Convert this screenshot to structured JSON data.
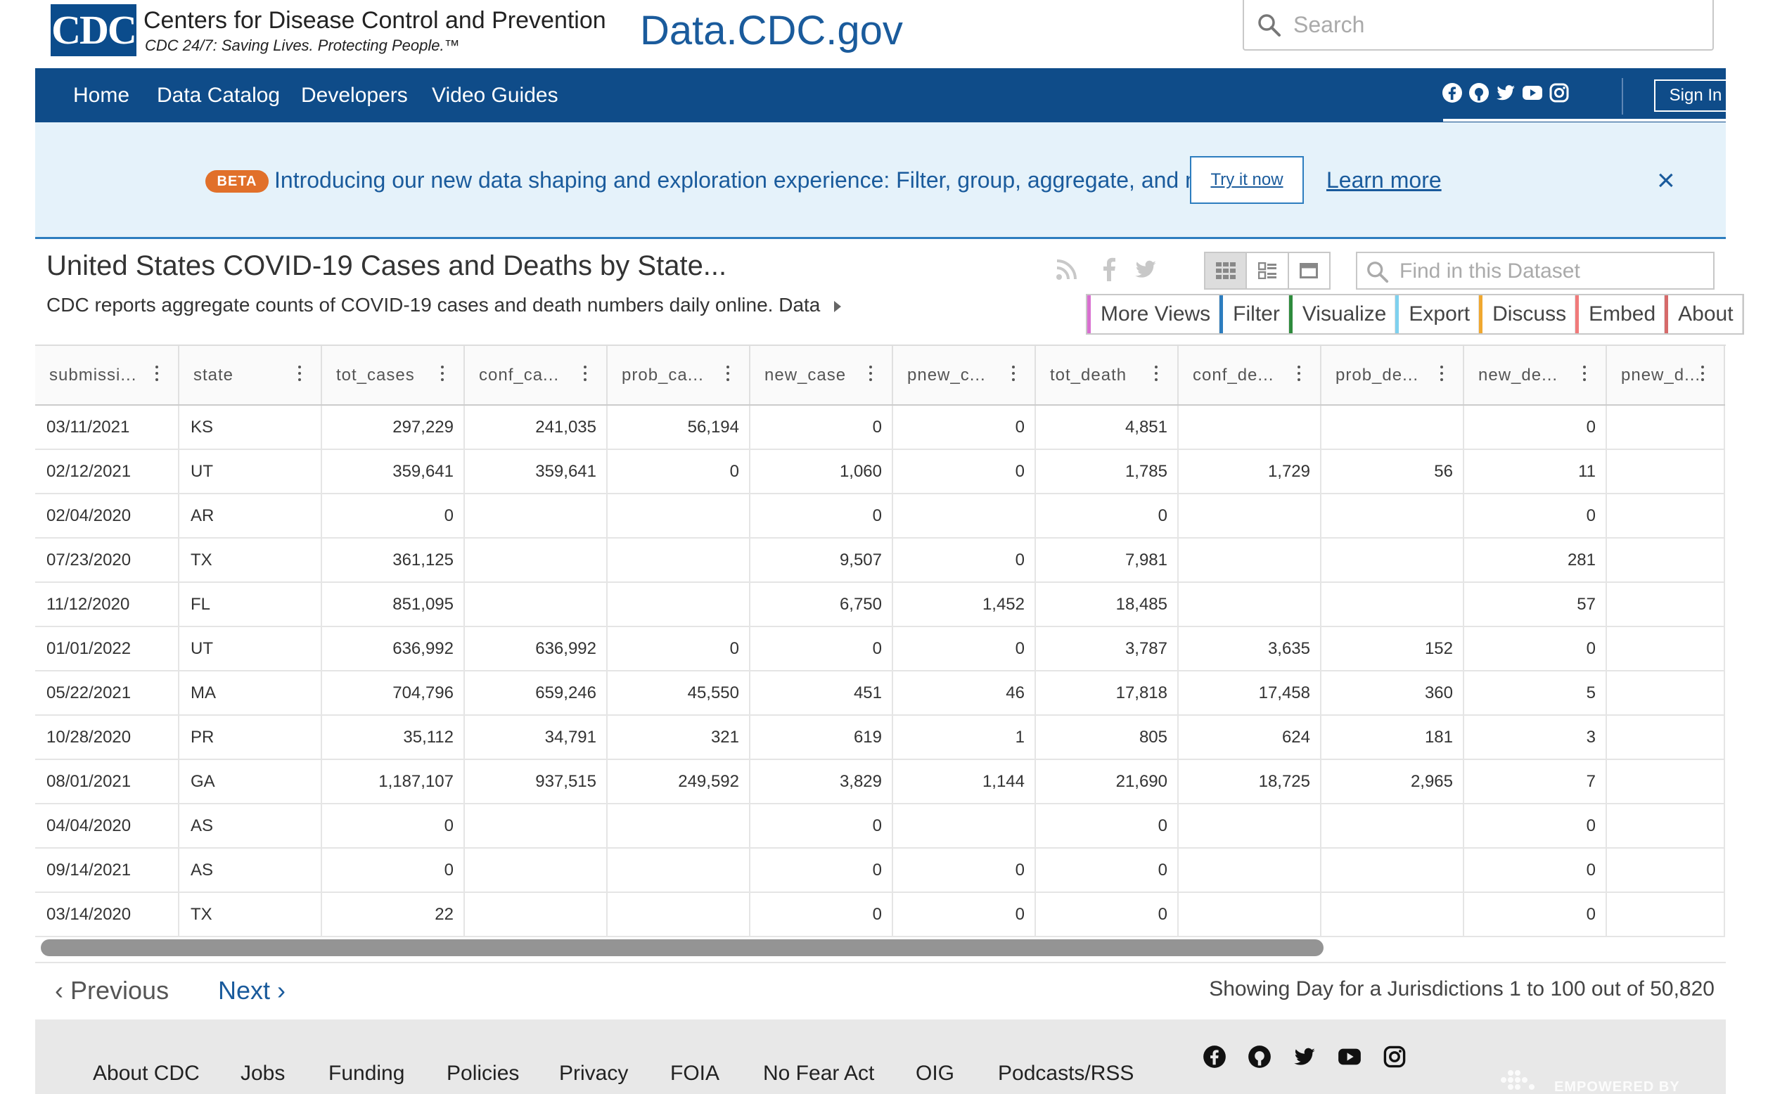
{
  "header": {
    "logo_text": "CDC",
    "org_name": "Centers for Disease Control and Prevention",
    "tagline": "CDC 24/7: Saving Lives. Protecting People.™",
    "portal_title": "Data.CDC.gov",
    "search_placeholder": "Search"
  },
  "nav": {
    "items": [
      "Home",
      "Data Catalog",
      "Developers",
      "Video Guides"
    ],
    "sign_in": "Sign In",
    "social_icons": [
      "facebook-icon",
      "github-icon",
      "twitter-icon",
      "youtube-icon",
      "instagram-icon"
    ]
  },
  "banner": {
    "badge": "BETA",
    "message": "Introducing our new data shaping and exploration experience: Filter, group, aggregate, and more!",
    "try_label": "Try it now",
    "learn_label": "Learn more",
    "close": "×"
  },
  "dataset": {
    "title": "United States COVID-19 Cases and Deaths by State...",
    "description": "CDC reports aggregate counts of COVID-19 cases and death numbers daily online. Data",
    "find_placeholder": "Find in this Dataset",
    "tabs": [
      {
        "label": "More Views",
        "color": "#d86fd0"
      },
      {
        "label": "Filter",
        "color": "#2d7dbf"
      },
      {
        "label": "Visualize",
        "color": "#2e8b3c"
      },
      {
        "label": "Export",
        "color": "#7fd1ee"
      },
      {
        "label": "Discuss",
        "color": "#f0a830"
      },
      {
        "label": "Embed",
        "color": "#f07a7a"
      },
      {
        "label": "About",
        "color": "#d66a6a"
      }
    ]
  },
  "table": {
    "columns": [
      "submissi...",
      "state",
      "tot_cases",
      "conf_ca...",
      "prob_ca...",
      "new_case",
      "pnew_c...",
      "tot_death",
      "conf_de...",
      "prob_de...",
      "new_de...",
      "pnew_d..."
    ],
    "rows": [
      [
        "03/11/2021",
        "KS",
        "297,229",
        "241,035",
        "56,194",
        "0",
        "0",
        "4,851",
        "",
        "",
        "0",
        ""
      ],
      [
        "02/12/2021",
        "UT",
        "359,641",
        "359,641",
        "0",
        "1,060",
        "0",
        "1,785",
        "1,729",
        "56",
        "11",
        ""
      ],
      [
        "02/04/2020",
        "AR",
        "0",
        "",
        "",
        "0",
        "",
        "0",
        "",
        "",
        "0",
        ""
      ],
      [
        "07/23/2020",
        "TX",
        "361,125",
        "",
        "",
        "9,507",
        "0",
        "7,981",
        "",
        "",
        "281",
        ""
      ],
      [
        "11/12/2020",
        "FL",
        "851,095",
        "",
        "",
        "6,750",
        "1,452",
        "18,485",
        "",
        "",
        "57",
        ""
      ],
      [
        "01/01/2022",
        "UT",
        "636,992",
        "636,992",
        "0",
        "0",
        "0",
        "3,787",
        "3,635",
        "152",
        "0",
        ""
      ],
      [
        "05/22/2021",
        "MA",
        "704,796",
        "659,246",
        "45,550",
        "451",
        "46",
        "17,818",
        "17,458",
        "360",
        "5",
        ""
      ],
      [
        "10/28/2020",
        "PR",
        "35,112",
        "34,791",
        "321",
        "619",
        "1",
        "805",
        "624",
        "181",
        "3",
        ""
      ],
      [
        "08/01/2021",
        "GA",
        "1,187,107",
        "937,515",
        "249,592",
        "3,829",
        "1,144",
        "21,690",
        "18,725",
        "2,965",
        "7",
        ""
      ],
      [
        "04/04/2020",
        "AS",
        "0",
        "",
        "",
        "0",
        "",
        "0",
        "",
        "",
        "0",
        ""
      ],
      [
        "09/14/2021",
        "AS",
        "0",
        "",
        "",
        "0",
        "0",
        "0",
        "",
        "",
        "0",
        ""
      ],
      [
        "03/14/2020",
        "TX",
        "22",
        "",
        "",
        "0",
        "0",
        "0",
        "",
        "",
        "0",
        ""
      ]
    ]
  },
  "pager": {
    "previous": "Previous",
    "next": "Next",
    "showing": "Showing Day for a Jurisdictions 1 to 100 out of 50,820"
  },
  "footer": {
    "links": [
      "About CDC",
      "Jobs",
      "Funding",
      "Policies",
      "Privacy",
      "FOIA",
      "No Fear Act",
      "OIG",
      "Podcasts/RSS"
    ],
    "social_icons": [
      "facebook-icon",
      "github-icon",
      "twitter-icon",
      "youtube-icon",
      "instagram-icon"
    ],
    "powered_by": "EMPOWERED BY TYLER TECHNOLOGIES"
  }
}
